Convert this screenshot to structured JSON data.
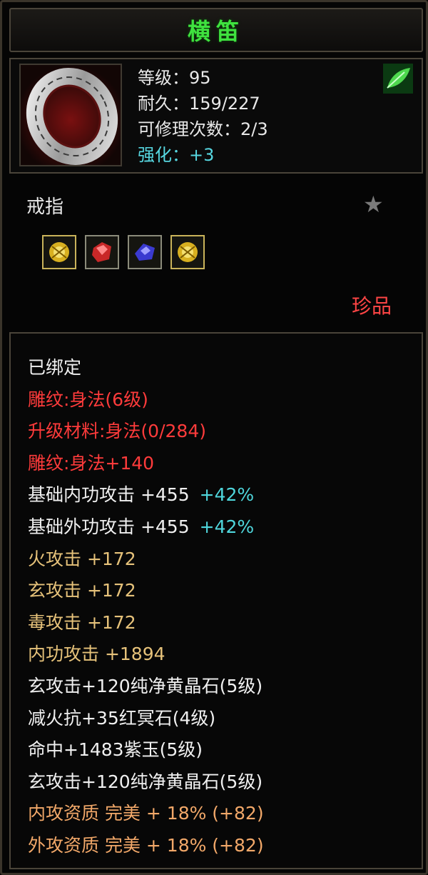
{
  "item": {
    "name": "横笛",
    "level_label": "等级：95",
    "durability_label": "耐久：159/227",
    "repair_label": "可修理次数：2/3",
    "enhance_label": "强化：+3",
    "type": "戒指",
    "rarity": "珍品",
    "icons": {
      "item": "silver-ring-icon",
      "badge": "green-leaf-icon",
      "favorite": "star-icon"
    },
    "gem_sockets": [
      {
        "name": "yellow-crystal-gem-icon",
        "color": "#e0c020"
      },
      {
        "name": "red-gem-icon",
        "color": "#d83030"
      },
      {
        "name": "purple-jade-gem-icon",
        "color": "#5050e0"
      },
      {
        "name": "yellow-crystal-gem-icon",
        "color": "#e0c020"
      }
    ]
  },
  "attributes": [
    {
      "text": "已绑定",
      "extra": "",
      "color": "white"
    },
    {
      "text": "雕纹:身法(6级)",
      "extra": "",
      "color": "red"
    },
    {
      "text": "升级材料:身法(0/284)",
      "extra": "",
      "color": "red"
    },
    {
      "text": "雕纹:身法+140",
      "extra": "",
      "color": "red"
    },
    {
      "text": "基础内功攻击 +455",
      "extra": "+42%",
      "color": "white"
    },
    {
      "text": "基础外功攻击 +455",
      "extra": "+42%",
      "color": "white"
    },
    {
      "text": "火攻击 +172",
      "extra": "",
      "color": "gold"
    },
    {
      "text": "玄攻击 +172",
      "extra": "",
      "color": "gold"
    },
    {
      "text": "毒攻击 +172",
      "extra": "",
      "color": "gold"
    },
    {
      "text": "内功攻击 +1894",
      "extra": "",
      "color": "gold"
    },
    {
      "text": "玄攻击+120纯净黄晶石(5级)",
      "extra": "",
      "color": "white"
    },
    {
      "text": "减火抗+35红冥石(4级)",
      "extra": "",
      "color": "white"
    },
    {
      "text": "命中+1483紫玉(5级)",
      "extra": "",
      "color": "white"
    },
    {
      "text": "玄攻击+120纯净黄晶石(5级)",
      "extra": "",
      "color": "white"
    },
    {
      "text": "内攻资质 完美 + 18% (+82)",
      "extra": "",
      "color": "orange"
    },
    {
      "text": "外攻资质 完美 + 18% (+82)",
      "extra": "",
      "color": "orange"
    }
  ],
  "colors": {
    "title": "#3fe23f",
    "white": "#f0f0f0",
    "red": "#ff3b3b",
    "gold": "#e6c27a",
    "orange": "#f2a869",
    "cyan": "#4fd6dc"
  }
}
